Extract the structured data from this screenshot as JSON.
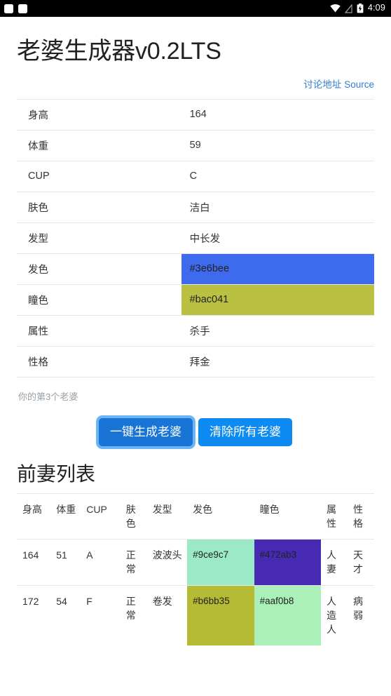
{
  "statusbar": {
    "clock": "4:09",
    "icons": [
      "notification-square-icon",
      "notification-square-icon",
      "wifi-icon",
      "signal-off-icon",
      "battery-charging-icon"
    ]
  },
  "header": {
    "title": "老婆生成器v0.2LTS",
    "links": [
      {
        "label": "讨论地址"
      },
      {
        "label": "Source"
      }
    ]
  },
  "attributes": {
    "rows": [
      {
        "key": "身高",
        "value": "164",
        "swatch": null
      },
      {
        "key": "体重",
        "value": "59",
        "swatch": null
      },
      {
        "key": "CUP",
        "value": "C",
        "swatch": null
      },
      {
        "key": "肤色",
        "value": "洁白",
        "swatch": null
      },
      {
        "key": "发型",
        "value": "中长发",
        "swatch": null
      },
      {
        "key": "发色",
        "value": "#3e6bee",
        "swatch": "#3e6bee"
      },
      {
        "key": "瞳色",
        "value": "#bac041",
        "swatch": "#bac041"
      },
      {
        "key": "属性",
        "value": "杀手",
        "swatch": null
      },
      {
        "key": "性格",
        "value": "拜金",
        "swatch": null
      }
    ]
  },
  "counter": {
    "text": "你的第3个老婆"
  },
  "actions": {
    "generate_label": "一键生成老婆",
    "clear_label": "清除所有老婆",
    "generate_color": "#1874d6",
    "generate_focus_ring": "#69b5f5",
    "clear_color": "#0d8bf2"
  },
  "exwives": {
    "title": "前妻列表",
    "columns": [
      "身高",
      "体重",
      "CUP",
      "肤色",
      "发型",
      "发色",
      "瞳色",
      "属性",
      "性格"
    ],
    "rows": [
      {
        "height": "164",
        "weight": "51",
        "cup": "A",
        "skin": "正常",
        "hairstyle": "波波头",
        "haircolor": "#9ce9c7",
        "eyecolor": "#472ab3",
        "attribute": "人妻",
        "personality": "天才"
      },
      {
        "height": "172",
        "weight": "54",
        "cup": "F",
        "skin": "正常",
        "hairstyle": "卷发",
        "haircolor": "#b6bb35",
        "eyecolor": "#aaf0b8",
        "attribute": "人造人",
        "personality": "病弱"
      }
    ]
  }
}
